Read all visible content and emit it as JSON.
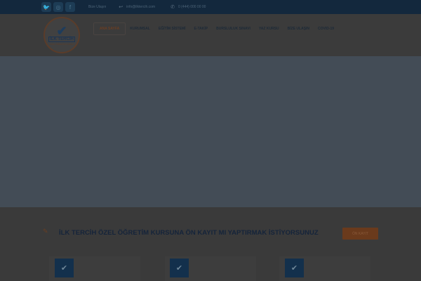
{
  "topbar": {
    "social": [
      {
        "name": "twitter",
        "glyph": "🐦"
      },
      {
        "name": "instagram",
        "glyph": "◎"
      },
      {
        "name": "facebook",
        "glyph": "f"
      }
    ],
    "info": [
      {
        "icon": "",
        "text": "Bize Ulaşın"
      },
      {
        "icon": "↩",
        "text": "info@ilktercih.com"
      },
      {
        "icon": "✆",
        "text": "0 (444) 000 00 00"
      }
    ]
  },
  "logo": {
    "title": "İLK TERCİH",
    "subtitle": "ÖZEL ÖĞRETİM KURSU"
  },
  "nav": [
    "ANA SAYFA",
    "KURUMSAL",
    "EĞİTİM SİSTEMİ",
    "E-TAKİP",
    "BURSLULUK SINAVI",
    "YAZ KURSU",
    "BİZE ULAŞIN",
    "COVID-19"
  ],
  "cta": {
    "title": "İLK TERCİH ÖZEL ÖĞRETİM KURSUNA ÖN KAYIT MI YAPTIRMAK İSTİYORSUNUZ",
    "button": "ÖN KAYIT"
  },
  "features": [
    {
      "icon": "✔"
    },
    {
      "icon": "✔"
    },
    {
      "icon": "✔"
    }
  ]
}
